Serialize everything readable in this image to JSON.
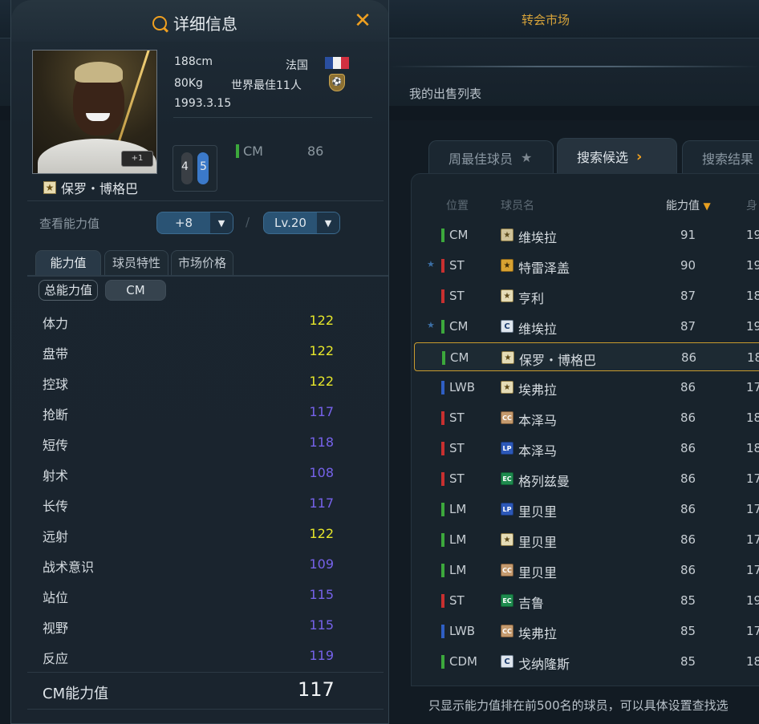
{
  "background": {
    "top_title": "转会市场",
    "my_sales_tab": "我的出售列表",
    "tabs": [
      {
        "label": "周最佳球员",
        "icon": "star-icon"
      },
      {
        "label": "搜索候选",
        "icon": "chevron-right-icon"
      },
      {
        "label": "搜索结果"
      }
    ],
    "columns": {
      "position": "位置",
      "name": "球员名",
      "ovr": "能力值",
      "height": "身"
    },
    "rows": [
      {
        "pos": "CM",
        "pos_color": "#3ca83c",
        "badge": "★",
        "badge_style": "icon",
        "name": "维埃拉",
        "ovr": "91",
        "height": "19",
        "fav": false
      },
      {
        "pos": "ST",
        "pos_color": "#c83030",
        "badge": "★",
        "badge_style": "toty",
        "name": "特雷泽盖",
        "ovr": "90",
        "height": "19",
        "fav": true
      },
      {
        "pos": "ST",
        "pos_color": "#c83030",
        "badge": "★",
        "badge_style": "base",
        "name": "亨利",
        "ovr": "87",
        "height": "18",
        "fav": false
      },
      {
        "pos": "CM",
        "pos_color": "#3ca83c",
        "badge": "C",
        "badge_style": "c",
        "name": "维埃拉",
        "ovr": "87",
        "height": "19",
        "fav": true
      },
      {
        "pos": "CM",
        "pos_color": "#3ca83c",
        "badge": "★",
        "badge_style": "base",
        "name": "保罗・博格巴",
        "ovr": "86",
        "height": "18",
        "fav": false
      },
      {
        "pos": "LWB",
        "pos_color": "#2f5fc4",
        "badge": "★",
        "badge_style": "base",
        "name": "埃弗拉",
        "ovr": "86",
        "height": "17",
        "fav": false
      },
      {
        "pos": "ST",
        "pos_color": "#c83030",
        "badge": "CC",
        "badge_style": "cc",
        "name": "本泽马",
        "ovr": "86",
        "height": "18",
        "fav": false
      },
      {
        "pos": "ST",
        "pos_color": "#c83030",
        "badge": "LP",
        "badge_style": "lp",
        "name": "本泽马",
        "ovr": "86",
        "height": "18",
        "fav": false
      },
      {
        "pos": "ST",
        "pos_color": "#c83030",
        "badge": "EC",
        "badge_style": "ec",
        "name": "格列兹曼",
        "ovr": "86",
        "height": "17",
        "fav": false
      },
      {
        "pos": "LM",
        "pos_color": "#3ca83c",
        "badge": "LP",
        "badge_style": "lp",
        "name": "里贝里",
        "ovr": "86",
        "height": "17",
        "fav": false
      },
      {
        "pos": "LM",
        "pos_color": "#3ca83c",
        "badge": "★",
        "badge_style": "base",
        "name": "里贝里",
        "ovr": "86",
        "height": "17",
        "fav": false
      },
      {
        "pos": "LM",
        "pos_color": "#3ca83c",
        "badge": "CC",
        "badge_style": "cc",
        "name": "里贝里",
        "ovr": "86",
        "height": "17",
        "fav": false
      },
      {
        "pos": "ST",
        "pos_color": "#c83030",
        "badge": "EC",
        "badge_style": "ec",
        "name": "吉鲁",
        "ovr": "85",
        "height": "19",
        "fav": false
      },
      {
        "pos": "LWB",
        "pos_color": "#2f5fc4",
        "badge": "CC",
        "badge_style": "cc",
        "name": "埃弗拉",
        "ovr": "85",
        "height": "17",
        "fav": false
      },
      {
        "pos": "CDM",
        "pos_color": "#3ca83c",
        "badge": "C",
        "badge_style": "c",
        "name": "戈纳隆斯",
        "ovr": "85",
        "height": "18",
        "fav": false
      }
    ],
    "selected_row": 4,
    "footer": "只显示能力值排在前500名的球员，可以具体设置查找选"
  },
  "modal": {
    "title": "详细信息",
    "close_icon": "close-icon",
    "player": {
      "name": "保罗・博格巴",
      "card_badge": "★",
      "portrait_badge": "+1",
      "height": "188cm",
      "weight": "80Kg",
      "birth": "1993.3.15",
      "nation": "法国",
      "award": "世界最佳11人",
      "foot_left": "4",
      "foot_right": "5",
      "position": "CM",
      "position_ovr": "86"
    },
    "view": {
      "label": "查看能力值",
      "boost": "+8",
      "level": "Lv.20",
      "separator": "/"
    },
    "tabs": [
      "能力值",
      "球员特性",
      "市场价格"
    ],
    "chips": {
      "total": "总能力值",
      "position": "CM"
    },
    "stats": [
      {
        "label": "体力",
        "value": "122",
        "tone": "yellow"
      },
      {
        "label": "盘带",
        "value": "122",
        "tone": "yellow"
      },
      {
        "label": "控球",
        "value": "122",
        "tone": "yellow"
      },
      {
        "label": "抢断",
        "value": "117",
        "tone": "purple"
      },
      {
        "label": "短传",
        "value": "118",
        "tone": "purple"
      },
      {
        "label": "射术",
        "value": "108",
        "tone": "purple"
      },
      {
        "label": "长传",
        "value": "117",
        "tone": "purple"
      },
      {
        "label": "远射",
        "value": "122",
        "tone": "yellow"
      },
      {
        "label": "战术意识",
        "value": "109",
        "tone": "purple"
      },
      {
        "label": "站位",
        "value": "115",
        "tone": "purple"
      },
      {
        "label": "视野",
        "value": "115",
        "tone": "purple"
      },
      {
        "label": "反应",
        "value": "119",
        "tone": "purple"
      }
    ],
    "summary": {
      "label": "CM能力值",
      "value": "117"
    }
  },
  "colors": {
    "accent": "#f0a020",
    "stat_high": "#e6e62a",
    "stat_mid": "#7662ea",
    "selected_border": "#c99b2e"
  }
}
